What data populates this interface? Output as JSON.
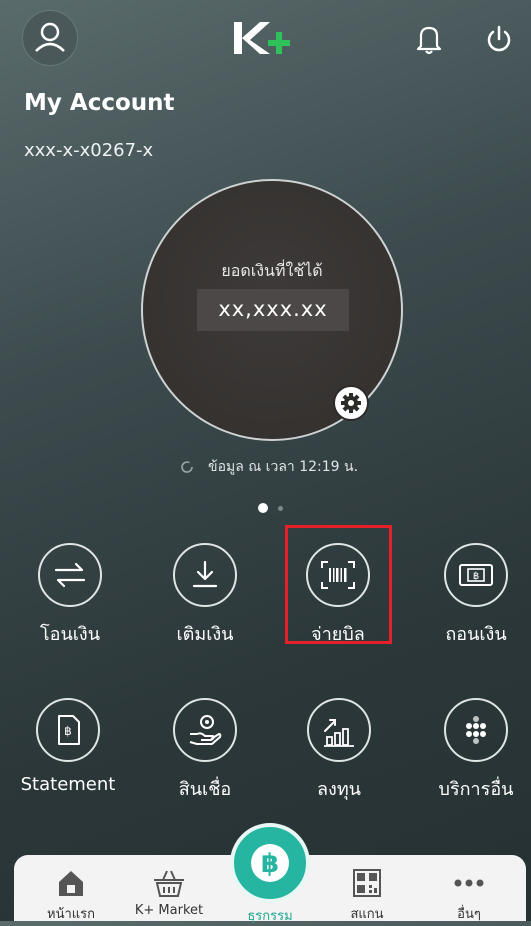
{
  "header": {
    "logo_text": "K+",
    "icons": [
      "user-icon",
      "bell-icon",
      "power-icon"
    ]
  },
  "account": {
    "title": "My Account",
    "number": "xxx-x-x0267-x"
  },
  "balance": {
    "label": "ยอดเงินที่ใช้ได้",
    "value": "xx,xxx.xx"
  },
  "update": {
    "text": "ข้อมูล ณ เวลา 12:19 น."
  },
  "menu": {
    "row1": [
      {
        "label": "โอนเงิน",
        "icon": "transfer-icon"
      },
      {
        "label": "เติมเงิน",
        "icon": "topup-icon"
      },
      {
        "label": "จ่ายบิล",
        "icon": "barcode-icon"
      },
      {
        "label": "ถอนเงิน",
        "icon": "withdraw-icon"
      }
    ],
    "row2": [
      {
        "label": "Statement",
        "icon": "statement-icon"
      },
      {
        "label": "สินเชื่อ",
        "icon": "loan-icon"
      },
      {
        "label": "ลงทุน",
        "icon": "invest-icon"
      },
      {
        "label": "บริการอื่น",
        "icon": "more-services-icon"
      }
    ]
  },
  "bottom_nav": [
    {
      "label": "หน้าแรก",
      "icon": "home-icon"
    },
    {
      "label": "K+ Market",
      "icon": "basket-icon"
    },
    {
      "label": "ธุรกรรม",
      "icon": "baht-icon"
    },
    {
      "label": "สแกน",
      "icon": "qr-icon"
    },
    {
      "label": "อื่นๆ",
      "icon": "more-icon"
    }
  ],
  "colors": {
    "accent": "#26b5a0",
    "logo_plus": "#2fc25b",
    "highlight": "#e4202a"
  }
}
